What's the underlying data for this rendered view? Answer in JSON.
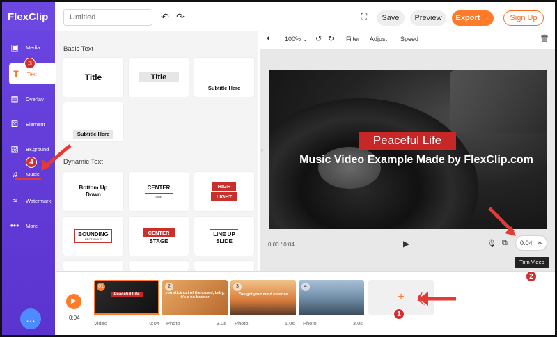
{
  "header": {
    "logo": "FlexClip",
    "title_placeholder": "Untitled",
    "save_label": "Save",
    "preview_label": "Preview",
    "export_label": "Export",
    "signup_label": "Sign Up"
  },
  "sidebar": {
    "items": [
      {
        "label": "Media"
      },
      {
        "label": "Text"
      },
      {
        "label": "Overlay"
      },
      {
        "label": "Element"
      },
      {
        "label": "BKground"
      },
      {
        "label": "Music"
      },
      {
        "label": "Watermark"
      },
      {
        "label": "More"
      }
    ]
  },
  "panel": {
    "basic_title": "Basic Text",
    "dynamic_title": "Dynamic Text",
    "basic_tiles": [
      "Title",
      "Title",
      "Subtitle Here",
      "Subtitle Here"
    ],
    "dynamic_tiles": [
      {
        "line1": "Bottom Up",
        "line2": "Down"
      },
      {
        "line1": "CENTER",
        "line2": "LINE"
      },
      {
        "line1": "HIGH",
        "line2": "LIGHT"
      },
      {
        "line1": "BOUNDING",
        "line2": "RECTANGLE"
      },
      {
        "line1": "CENTER",
        "line2": "STAGE"
      },
      {
        "line1": "LINE UP",
        "line2": "SLIDE"
      }
    ]
  },
  "toolbar": {
    "zoom": "100%",
    "filter": "Filter",
    "adjust": "Adjust",
    "speed": "Speed"
  },
  "preview": {
    "video_title": "Peaceful Life",
    "video_subtitle": "Music Video Example Made by FlexClip.com",
    "time": "0:00 / 0:04",
    "trim_duration": "0:04",
    "trim_tooltip": "Trim Video"
  },
  "timeline": {
    "time": "0:04",
    "clips": [
      {
        "num": "01",
        "type": "Video",
        "duration": "0:04",
        "text": "Peaceful Life"
      },
      {
        "num": "2",
        "type": "Photo",
        "duration": "3.0s",
        "text": "you stick out of the crowd, baby, it's a no-brainer"
      },
      {
        "num": "3",
        "type": "Photo",
        "duration": "1.0s",
        "text": "You got your mind unloose"
      },
      {
        "num": "4",
        "type": "Photo",
        "duration": "3.0s",
        "text": ""
      }
    ]
  },
  "annotations": [
    "1",
    "2",
    "3",
    "4"
  ]
}
